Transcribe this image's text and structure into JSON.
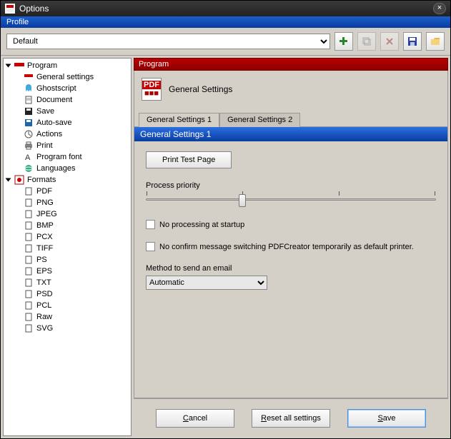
{
  "window": {
    "title": "Options"
  },
  "profile": {
    "label": "Profile",
    "selected": "Default",
    "options": [
      "Default"
    ]
  },
  "toolbar_icons": [
    "add",
    "copy",
    "delete",
    "save",
    "open"
  ],
  "tree": {
    "program": {
      "label": "Program",
      "children": [
        {
          "icon": "pdf",
          "label": "General settings"
        },
        {
          "icon": "ghost",
          "label": "Ghostscript"
        },
        {
          "icon": "doc",
          "label": "Document"
        },
        {
          "icon": "save",
          "label": "Save"
        },
        {
          "icon": "autosave",
          "label": "Auto-save"
        },
        {
          "icon": "actions",
          "label": "Actions"
        },
        {
          "icon": "print",
          "label": "Print"
        },
        {
          "icon": "font",
          "label": "Program font"
        },
        {
          "icon": "lang",
          "label": "Languages"
        }
      ]
    },
    "formats": {
      "label": "Formats",
      "children": [
        {
          "icon": "fmt",
          "label": "PDF"
        },
        {
          "icon": "fmt",
          "label": "PNG"
        },
        {
          "icon": "fmt",
          "label": "JPEG"
        },
        {
          "icon": "fmt",
          "label": "BMP"
        },
        {
          "icon": "fmt",
          "label": "PCX"
        },
        {
          "icon": "fmt",
          "label": "TIFF"
        },
        {
          "icon": "fmt",
          "label": "PS"
        },
        {
          "icon": "fmt",
          "label": "EPS"
        },
        {
          "icon": "fmt",
          "label": "TXT"
        },
        {
          "icon": "fmt",
          "label": "PSD"
        },
        {
          "icon": "fmt",
          "label": "PCL"
        },
        {
          "icon": "fmt",
          "label": "Raw"
        },
        {
          "icon": "fmt",
          "label": "SVG"
        }
      ]
    }
  },
  "page": {
    "section": "Program",
    "title": "General Settings",
    "tabs": [
      "General Settings 1",
      "General Settings 2"
    ],
    "active_tab": 0,
    "subsection": "General Settings 1",
    "print_test_label": "Print Test Page",
    "priority_label": "Process priority",
    "priority_value": 1,
    "priority_ticks": 4,
    "chk_no_processing": {
      "checked": false,
      "label": "No processing at startup"
    },
    "chk_no_confirm": {
      "checked": false,
      "label": "No confirm message switching PDFCreator temporarily as default printer."
    },
    "email_label": "Method to send an email",
    "email_value": "Automatic",
    "email_options": [
      "Automatic"
    ]
  },
  "buttons": {
    "cancel": "Cancel",
    "reset": "Reset all settings",
    "save": "Save"
  }
}
